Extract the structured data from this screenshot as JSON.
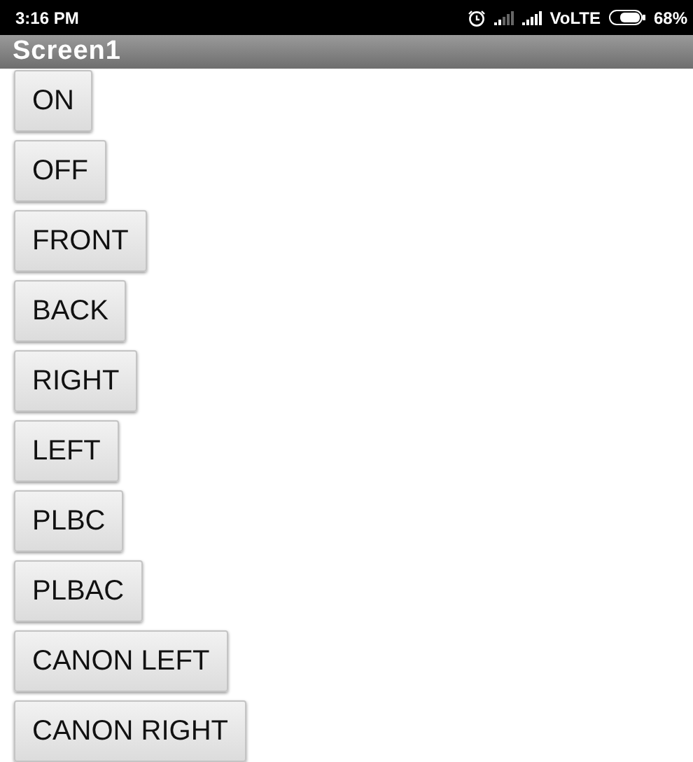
{
  "status_bar": {
    "time": "3:16 PM",
    "network": "VoLTE",
    "battery": "68%"
  },
  "title_bar": {
    "title": "Screen1"
  },
  "buttons": [
    "ON",
    "OFF",
    "FRONT",
    "BACK",
    "RIGHT",
    "LEFT",
    "PLBC",
    "PLBAC",
    "CANON LEFT",
    "CANON RIGHT"
  ]
}
